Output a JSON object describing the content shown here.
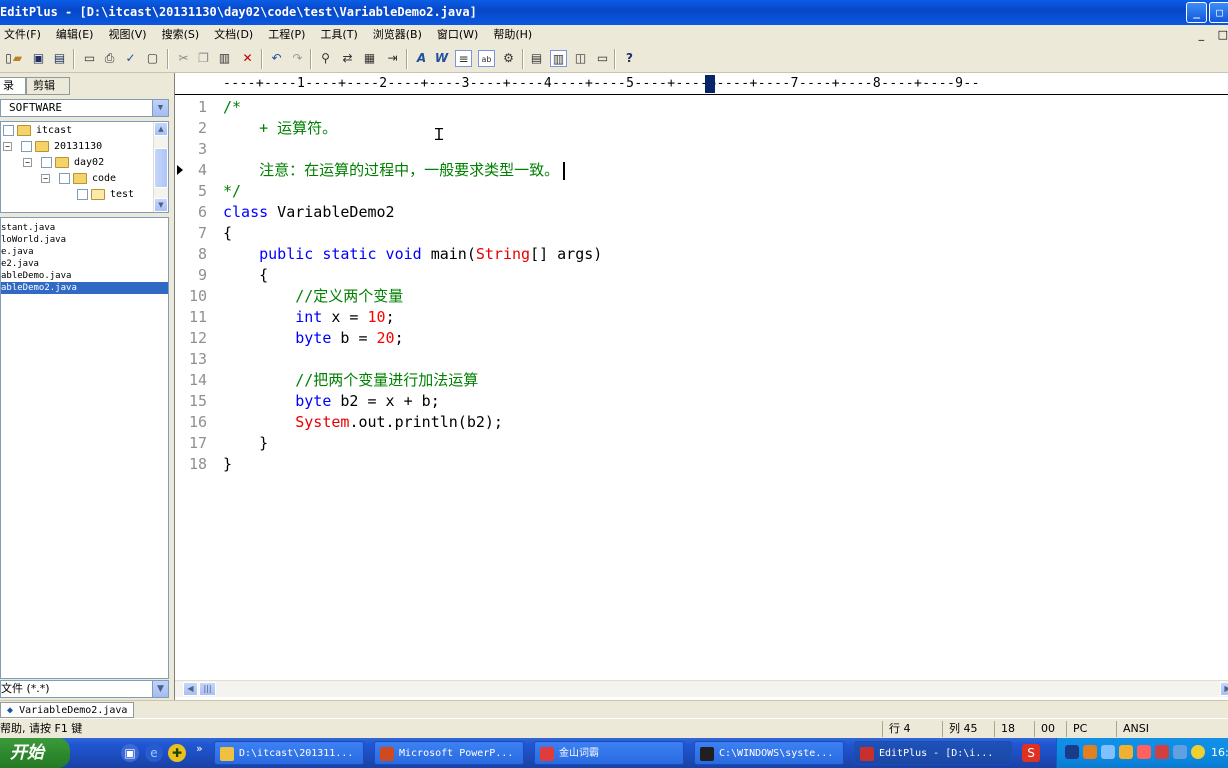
{
  "window": {
    "title": "EditPlus - [D:\\itcast\\20131130\\day02\\code\\test\\VariableDemo2.java]",
    "minimize": "_",
    "maximize": "□",
    "close": "✕"
  },
  "menubar": {
    "items": [
      "文件(F)",
      "编辑(E)",
      "视图(V)",
      "搜索(S)",
      "文档(D)",
      "工程(P)",
      "工具(T)",
      "浏览器(B)",
      "窗口(W)",
      "帮助(H)"
    ],
    "right_min": "_",
    "right_restore": "□"
  },
  "sidebar": {
    "tabs": [
      "录",
      "剪辑"
    ],
    "drive": "SOFTWARE",
    "tree": [
      {
        "label": "itcast",
        "level": 0,
        "expander": ""
      },
      {
        "label": "20131130",
        "level": 1,
        "expander": "−"
      },
      {
        "label": "day02",
        "level": 2,
        "expander": "−"
      },
      {
        "label": "code",
        "level": 3,
        "expander": "−"
      },
      {
        "label": "test",
        "level": 4,
        "expander": ""
      }
    ],
    "files": [
      "stant.java",
      "loWorld.java",
      "e.java",
      "e2.java",
      "ableDemo.java",
      "ableDemo2.java"
    ],
    "selected_file_index": 5,
    "filter": "文件 (*.*)"
  },
  "editor": {
    "ruler": "----+----1----+----2----+----3----+----4----+----5----+----6----+----7----+----8----+----9--",
    "current_line": 4,
    "lines": [
      {
        "n": "1",
        "tokens": [
          {
            "t": "/*",
            "c": "com"
          }
        ]
      },
      {
        "n": "2",
        "tokens": [
          {
            "t": "    + 运算符。",
            "c": "com"
          }
        ]
      },
      {
        "n": "3",
        "tokens": []
      },
      {
        "n": "4",
        "tokens": [
          {
            "t": "    注意：在运算的过程中，一般要求类型一致。",
            "c": "com"
          }
        ],
        "caret": true
      },
      {
        "n": "5",
        "tokens": [
          {
            "t": "*/",
            "c": "com"
          }
        ]
      },
      {
        "n": "6",
        "tokens": [
          {
            "t": "class",
            "c": "key"
          },
          {
            "t": " VariableDemo2",
            "c": "plain"
          }
        ]
      },
      {
        "n": "7",
        "tokens": [
          {
            "t": "{",
            "c": "plain"
          }
        ]
      },
      {
        "n": "8",
        "tokens": [
          {
            "t": "    ",
            "c": "plain"
          },
          {
            "t": "public static void",
            "c": "key"
          },
          {
            "t": " main(",
            "c": "plain"
          },
          {
            "t": "String",
            "c": "cls"
          },
          {
            "t": "[] args)",
            "c": "plain"
          }
        ]
      },
      {
        "n": "9",
        "tokens": [
          {
            "t": "    {",
            "c": "plain"
          }
        ]
      },
      {
        "n": "10",
        "tokens": [
          {
            "t": "        //定义两个变量",
            "c": "com"
          }
        ]
      },
      {
        "n": "11",
        "tokens": [
          {
            "t": "        ",
            "c": "plain"
          },
          {
            "t": "int",
            "c": "key"
          },
          {
            "t": " x = ",
            "c": "plain"
          },
          {
            "t": "10",
            "c": "num"
          },
          {
            "t": ";",
            "c": "plain"
          }
        ]
      },
      {
        "n": "12",
        "tokens": [
          {
            "t": "        ",
            "c": "plain"
          },
          {
            "t": "byte",
            "c": "key"
          },
          {
            "t": " b = ",
            "c": "plain"
          },
          {
            "t": "20",
            "c": "num"
          },
          {
            "t": ";",
            "c": "plain"
          }
        ]
      },
      {
        "n": "13",
        "tokens": []
      },
      {
        "n": "14",
        "tokens": [
          {
            "t": "        //把两个变量进行加法运算",
            "c": "com"
          }
        ]
      },
      {
        "n": "15",
        "tokens": [
          {
            "t": "        ",
            "c": "plain"
          },
          {
            "t": "byte",
            "c": "key"
          },
          {
            "t": " b2 = x + b;",
            "c": "plain"
          }
        ]
      },
      {
        "n": "16",
        "tokens": [
          {
            "t": "        ",
            "c": "plain"
          },
          {
            "t": "System",
            "c": "cls"
          },
          {
            "t": ".out.println(b2);",
            "c": "plain"
          }
        ]
      },
      {
        "n": "17",
        "tokens": [
          {
            "t": "    }",
            "c": "plain"
          }
        ]
      },
      {
        "n": "18",
        "tokens": [
          {
            "t": "}",
            "c": "plain"
          }
        ]
      }
    ]
  },
  "doctabs": {
    "active": "VariableDemo2.java"
  },
  "status": {
    "help": "帮助, 请按 F1 键",
    "line": "行 4",
    "col": "列 45",
    "f1": "18",
    "f2": "00",
    "f3": "PC",
    "encoding": "ANSI"
  },
  "taskbar": {
    "start": "开始",
    "buttons": [
      {
        "label": "D:\\itcast\\201311...",
        "color": "#f0c040"
      },
      {
        "label": "Microsoft PowerP...",
        "color": "#d04a20"
      },
      {
        "label": "金山词霸",
        "color": "#e03c3c"
      },
      {
        "label": "C:\\WINDOWS\\syste...",
        "color": "#202020"
      },
      {
        "label": "EditPlus - [D:\\i...",
        "color": "#c83030"
      }
    ],
    "clock": "16:"
  },
  "colors": {
    "comment": "#008000",
    "keyword": "#0000ff",
    "number": "#ff0000",
    "class": "#e60000",
    "selection": "#316ac5"
  }
}
